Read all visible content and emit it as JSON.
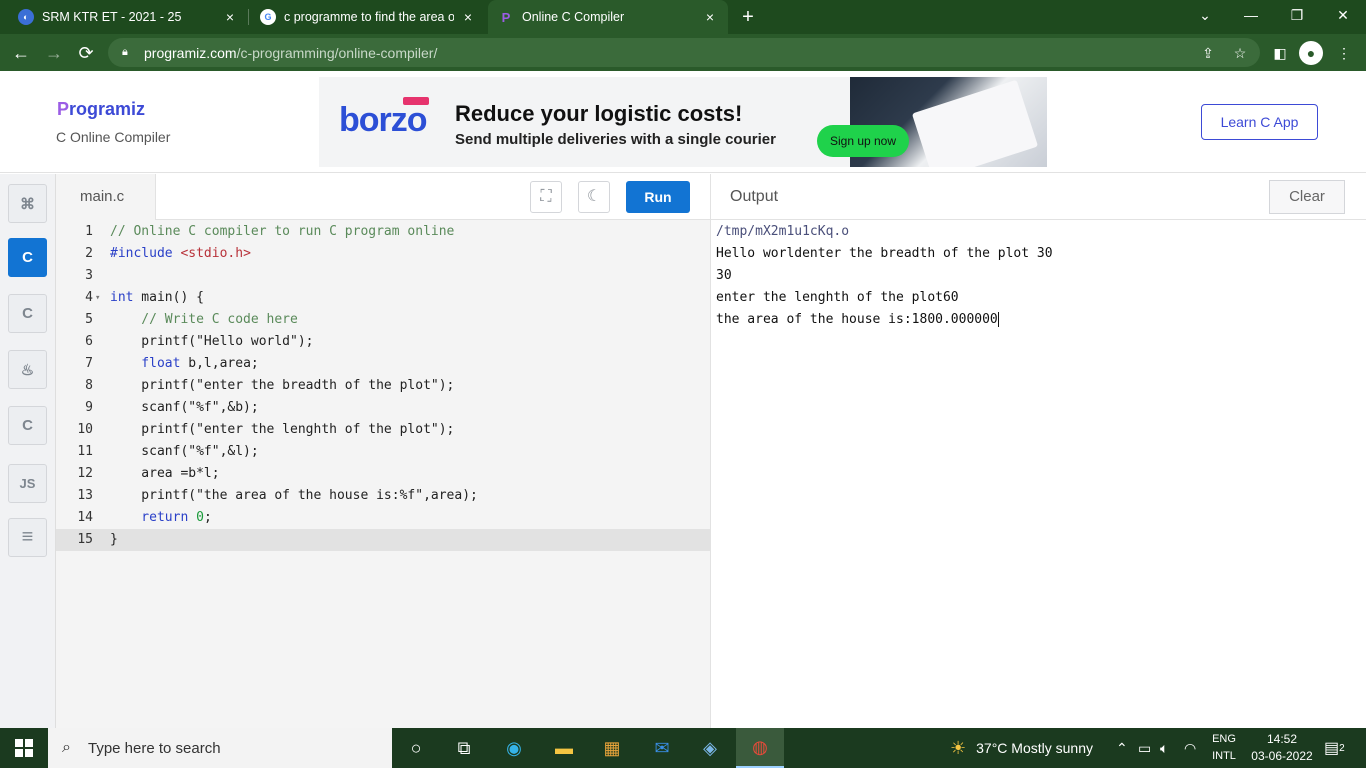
{
  "browser": {
    "tabs": [
      {
        "title": "SRM KTR ET - 2021 - 25",
        "close": "×"
      },
      {
        "title": "c programme to find the area of",
        "close": "×"
      },
      {
        "title": "Online C Compiler",
        "close": "×"
      }
    ],
    "new_tab": "+",
    "window_controls": {
      "dropdown": "⌄",
      "minimize": "—",
      "restore": "❐",
      "close": "✕"
    },
    "url_host": "programiz.com",
    "url_path": "/c-programming/online-compiler/",
    "back": "←",
    "forward": "→",
    "reload": "⟳"
  },
  "header": {
    "logo": "rogramiz",
    "logo_p": "P",
    "subtitle": "C Online Compiler",
    "learn_button": "Learn C App",
    "ad": {
      "brand": "borzo",
      "headline": "Reduce your logistic costs!",
      "subline": "Send multiple deliveries with a single courier",
      "cta": "Sign up now"
    }
  },
  "rail": {
    "items": [
      {
        "icon": "python-icon",
        "glyph": "⌘"
      },
      {
        "icon": "c-icon",
        "glyph": "C"
      },
      {
        "icon": "cpp-icon",
        "glyph": "C"
      },
      {
        "icon": "java-icon",
        "glyph": "♨"
      },
      {
        "icon": "csharp-icon",
        "glyph": "C"
      },
      {
        "icon": "javascript-icon",
        "glyph": "JS"
      },
      {
        "icon": "sql-icon",
        "glyph": "≡"
      }
    ],
    "active_index": 1
  },
  "editor": {
    "filename": "main.c",
    "run_label": "Run",
    "fullscreen_glyph": "⛶",
    "theme_glyph": "☾",
    "lines": [
      {
        "n": "1"
      },
      {
        "n": "2"
      },
      {
        "n": "3"
      },
      {
        "n": "4"
      },
      {
        "n": "5"
      },
      {
        "n": "6"
      },
      {
        "n": "7"
      },
      {
        "n": "8"
      },
      {
        "n": "9"
      },
      {
        "n": "10"
      },
      {
        "n": "11"
      },
      {
        "n": "12"
      },
      {
        "n": "13"
      },
      {
        "n": "14"
      },
      {
        "n": "15"
      }
    ],
    "code": {
      "l1": "// Online C compiler to run C program online",
      "l2a": "#include ",
      "l2b": "<stdio.h>",
      "l4a": "int",
      "l4b": " main() {",
      "l5": "    // Write C code here",
      "l6": "    printf(\"Hello world\");",
      "l7a": "    float",
      "l7b": " b,l,area;",
      "l8": "    printf(\"enter the breadth of the plot\");",
      "l9": "    scanf(\"%f\",&b);",
      "l10": "    printf(\"enter the lenghth of the plot\");",
      "l11": "    scanf(\"%f\",&l);",
      "l12": "    area =b*l;",
      "l13": "    printf(\"the area of the house is:%f\",area);",
      "l14a": "    return",
      "l14b": " 0",
      "l14c": ";",
      "l15": "}"
    }
  },
  "output": {
    "title": "Output",
    "clear_label": "Clear",
    "lines": [
      "/tmp/mX2m1u1cKq.o",
      "Hello worldenter the breadth of the plot 30",
      "30",
      "enter the lenghth of the plot60",
      "the area of the house is:1800.000000"
    ]
  },
  "taskbar": {
    "search_placeholder": "Type here to search",
    "weather": "37°C  Mostly sunny",
    "lang_top": "ENG",
    "lang_bottom": "INTL",
    "time": "14:52",
    "date": "03-06-2022",
    "notifications": "2"
  }
}
